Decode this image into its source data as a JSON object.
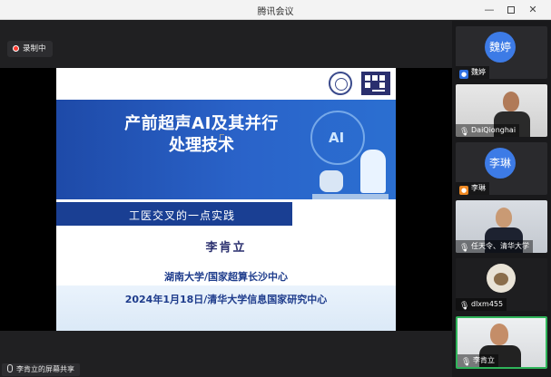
{
  "window": {
    "title": "腾讯会议",
    "minimize": "—",
    "close": "✕"
  },
  "recording": {
    "label": "录制中"
  },
  "slide": {
    "title_line1": "产前超声AI及其并行",
    "title_line2": "处理技术",
    "subtitle": "工医交叉的一点实践",
    "author": "李肯立",
    "affiliation1": "湖南大学/国家超算长沙中心",
    "affiliation2": "2024年1月18日/清华大学信息国家研究中心",
    "graphic_text": "AI"
  },
  "participants": [
    {
      "name": "魏婷",
      "avatar_text": "魏婷",
      "type": "avatar",
      "mic": "blue",
      "mic_icon": "user-icon"
    },
    {
      "name": "DaiQionghai",
      "type": "video",
      "mic": "white",
      "mic_icon": "mic-icon"
    },
    {
      "name": "李琳",
      "avatar_text": "李琳",
      "type": "avatar",
      "mic": "orange",
      "mic_icon": "user-icon"
    },
    {
      "name": "任天令、清华大学",
      "type": "video",
      "mic": "white",
      "mic_icon": "mic-icon"
    },
    {
      "name": "dlxm455",
      "type": "image",
      "mic": "white",
      "mic_icon": "mic-icon"
    },
    {
      "name": "李肯立",
      "type": "video",
      "mic": "white",
      "mic_icon": "mic-icon",
      "active": true
    }
  ],
  "screen_share": {
    "label": "李肯立的屏幕共享"
  },
  "colors": {
    "accent_green": "#2fb45a",
    "avatar_blue": "#3d7be6",
    "banner_blue": "#1e4aa8"
  }
}
